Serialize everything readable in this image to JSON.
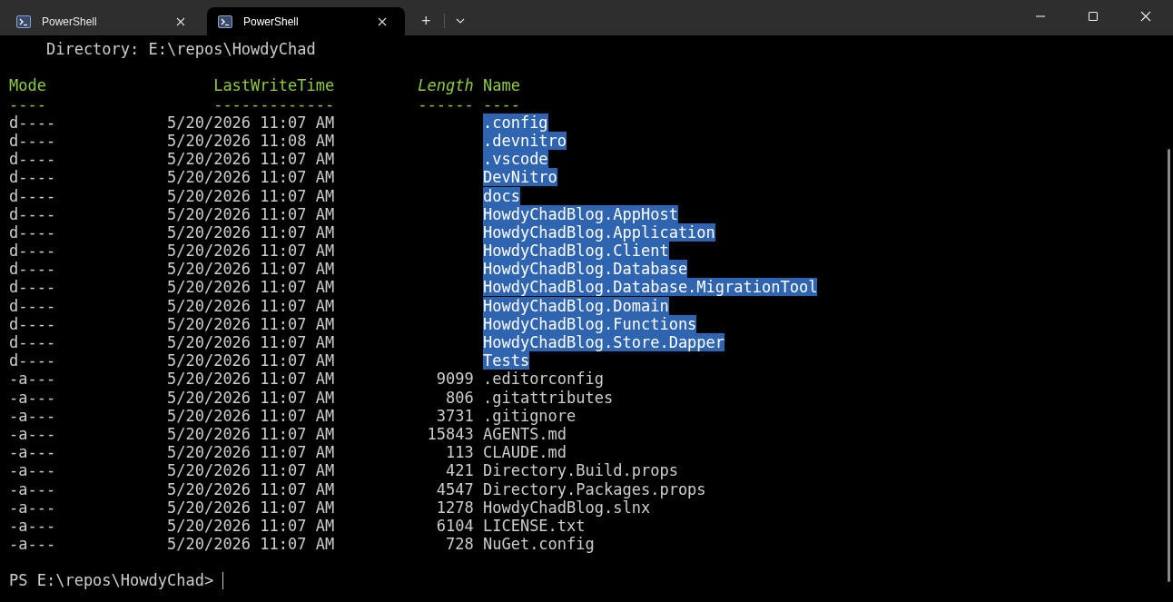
{
  "tabs": [
    {
      "title": "PowerShell",
      "selected": false
    },
    {
      "title": "PowerShell",
      "selected": true
    }
  ],
  "new_tab": "+",
  "directory_line": "    Directory: E:\\repos\\HowdyChad",
  "columns": [
    {
      "label": "Mode",
      "rule": "----",
      "italic": false
    },
    {
      "label": "LastWriteTime",
      "rule": "-------------",
      "italic": false
    },
    {
      "label": "Length",
      "rule": "------",
      "italic": true
    },
    {
      "label": "Name",
      "rule": "----",
      "italic": false
    }
  ],
  "rows": [
    {
      "mode": "d----",
      "time": "5/20/2026 11:07 AM",
      "name": ".config",
      "selected": true
    },
    {
      "mode": "d----",
      "time": "5/20/2026 11:08 AM",
      "name": ".devnitro",
      "selected": true
    },
    {
      "mode": "d----",
      "time": "5/20/2026 11:07 AM",
      "name": ".vscode",
      "selected": true
    },
    {
      "mode": "d----",
      "time": "5/20/2026 11:07 AM",
      "name": "DevNitro",
      "selected": true
    },
    {
      "mode": "d----",
      "time": "5/20/2026 11:07 AM",
      "name": "docs",
      "selected": true
    },
    {
      "mode": "d----",
      "time": "5/20/2026 11:07 AM",
      "name": "HowdyChadBlog.AppHost",
      "selected": true
    },
    {
      "mode": "d----",
      "time": "5/20/2026 11:07 AM",
      "name": "HowdyChadBlog.Application",
      "selected": true
    },
    {
      "mode": "d----",
      "time": "5/20/2026 11:07 AM",
      "name": "HowdyChadBlog.Client",
      "selected": true
    },
    {
      "mode": "d----",
      "time": "5/20/2026 11:07 AM",
      "name": "HowdyChadBlog.Database",
      "selected": true
    },
    {
      "mode": "d----",
      "time": "5/20/2026 11:07 AM",
      "name": "HowdyChadBlog.Database.MigrationTool",
      "selected": true
    },
    {
      "mode": "d----",
      "time": "5/20/2026 11:07 AM",
      "name": "HowdyChadBlog.Domain",
      "selected": true
    },
    {
      "mode": "d----",
      "time": "5/20/2026 11:07 AM",
      "name": "HowdyChadBlog.Functions",
      "selected": true
    },
    {
      "mode": "d----",
      "time": "5/20/2026 11:07 AM",
      "name": "HowdyChadBlog.Store.Dapper",
      "selected": true
    },
    {
      "mode": "d----",
      "time": "5/20/2026 11:07 AM",
      "name": "Tests",
      "selected": true
    },
    {
      "mode": "-a---",
      "time": "5/20/2026 11:07 AM",
      "length": "9099",
      "name": ".editorconfig",
      "selected": false
    },
    {
      "mode": "-a---",
      "time": "5/20/2026 11:07 AM",
      "length": "806",
      "name": ".gitattributes",
      "selected": false
    },
    {
      "mode": "-a---",
      "time": "5/20/2026 11:07 AM",
      "length": "3731",
      "name": ".gitignore",
      "selected": false
    },
    {
      "mode": "-a---",
      "time": "5/20/2026 11:07 AM",
      "length": "15843",
      "name": "AGENTS.md",
      "selected": false
    },
    {
      "mode": "-a---",
      "time": "5/20/2026 11:07 AM",
      "length": "113",
      "name": "CLAUDE.md",
      "selected": false
    },
    {
      "mode": "-a---",
      "time": "5/20/2026 11:07 AM",
      "length": "421",
      "name": "Directory.Build.props",
      "selected": false
    },
    {
      "mode": "-a---",
      "time": "5/20/2026 11:07 AM",
      "length": "4547",
      "name": "Directory.Packages.props",
      "selected": false
    },
    {
      "mode": "-a---",
      "time": "5/20/2026 11:07 AM",
      "length": "1278",
      "name": "HowdyChadBlog.slnx",
      "selected": false
    },
    {
      "mode": "-a---",
      "time": "5/20/2026 11:07 AM",
      "length": "6104",
      "name": "LICENSE.txt",
      "selected": false
    },
    {
      "mode": "-a---",
      "time": "5/20/2026 11:07 AM",
      "length": "728",
      "name": "NuGet.config",
      "selected": false
    }
  ],
  "prompt": "PS E:\\repos\\HowdyChad>"
}
